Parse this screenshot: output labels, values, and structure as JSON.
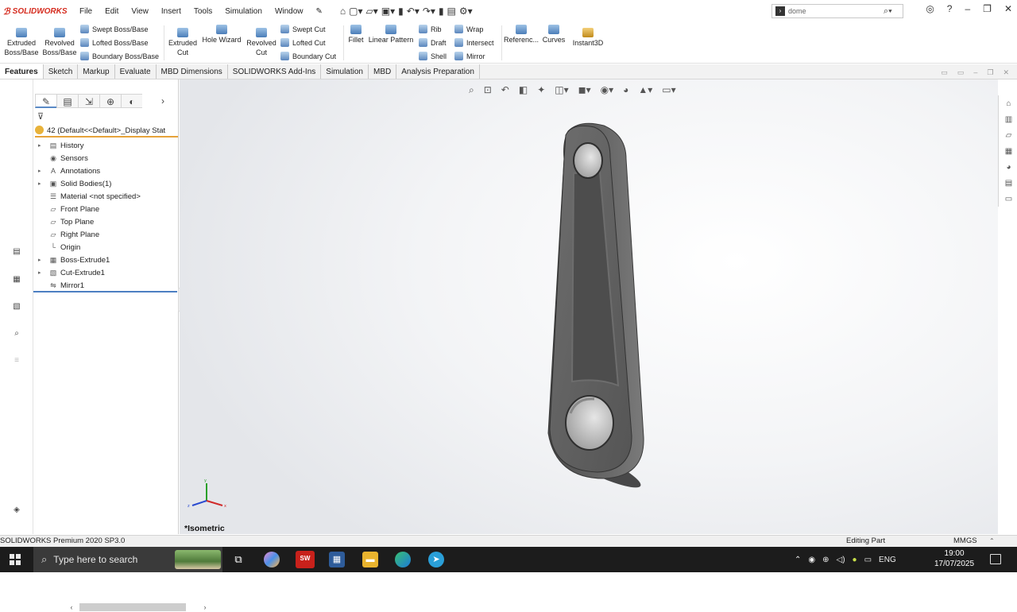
{
  "app": {
    "logo_text": "SOLIDWORKS",
    "menus": [
      "File",
      "Edit",
      "View",
      "Insert",
      "Tools",
      "Simulation",
      "Window"
    ],
    "search_value": "dome",
    "accent_color": "#d52b1e"
  },
  "ribbon": {
    "extruded_boss": "Extruded Boss/Base",
    "revolved_boss": "Revolved Boss/Base",
    "swept_boss": "Swept Boss/Base",
    "lofted_boss": "Lofted Boss/Base",
    "boundary_boss": "Boundary Boss/Base",
    "extruded_cut": "Extruded Cut",
    "hole_wizard": "Hole Wizard",
    "revolved_cut": "Revolved Cut",
    "swept_cut": "Swept Cut",
    "lofted_cut": "Lofted Cut",
    "boundary_cut": "Boundary Cut",
    "fillet": "Fillet",
    "linear_pattern": "Linear Pattern",
    "rib": "Rib",
    "draft": "Draft",
    "shell": "Shell",
    "wrap": "Wrap",
    "intersect": "Intersect",
    "mirror": "Mirror",
    "reference": "Referenc...",
    "curves": "Curves",
    "instant3d": "Instant3D"
  },
  "tabs": [
    {
      "label": "Features",
      "active": true
    },
    {
      "label": "Sketch"
    },
    {
      "label": "Markup"
    },
    {
      "label": "Evaluate"
    },
    {
      "label": "MBD Dimensions"
    },
    {
      "label": "SOLIDWORKS Add-Ins"
    },
    {
      "label": "Simulation"
    },
    {
      "label": "MBD"
    },
    {
      "label": "Analysis Preparation"
    }
  ],
  "tree": {
    "part_name": "42  (Default<<Default>_Display Stat",
    "items": [
      {
        "label": "History",
        "expandable": true,
        "icon": "history-icon"
      },
      {
        "label": "Sensors",
        "expandable": false,
        "icon": "sensors-icon"
      },
      {
        "label": "Annotations",
        "expandable": true,
        "icon": "annotations-icon"
      },
      {
        "label": "Solid Bodies(1)",
        "expandable": true,
        "icon": "solid-bodies-icon"
      },
      {
        "label": "Material <not specified>",
        "expandable": false,
        "icon": "material-icon"
      },
      {
        "label": "Front Plane",
        "expandable": false,
        "icon": "plane-icon"
      },
      {
        "label": "Top Plane",
        "expandable": false,
        "icon": "plane-icon"
      },
      {
        "label": "Right Plane",
        "expandable": false,
        "icon": "plane-icon"
      },
      {
        "label": "Origin",
        "expandable": false,
        "icon": "origin-icon"
      },
      {
        "label": "Boss-Extrude1",
        "expandable": true,
        "icon": "extrude-icon"
      },
      {
        "label": "Cut-Extrude1",
        "expandable": true,
        "icon": "cut-icon"
      },
      {
        "label": "Mirror1",
        "expandable": false,
        "icon": "mirror-icon"
      }
    ]
  },
  "viewport": {
    "view_name": "*Isometric",
    "triad_axes": [
      "y",
      "x",
      "z"
    ],
    "model_color": "#5b5b5b"
  },
  "status": {
    "product": "SOLIDWORKS Premium 2020 SP3.0",
    "mode": "Editing Part",
    "units": "MMGS"
  },
  "taskbar": {
    "search_placeholder": "Type here to search",
    "language": "ENG",
    "time": "19:00",
    "date": "17/07/2025"
  }
}
